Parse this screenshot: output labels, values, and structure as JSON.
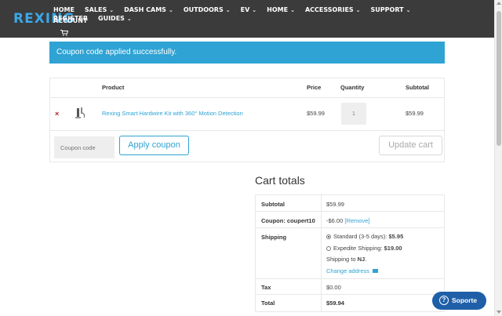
{
  "header": {
    "logo": "REXING",
    "nav": [
      {
        "label": "HOME",
        "dropdown": false
      },
      {
        "label": "SALES",
        "dropdown": true
      },
      {
        "label": "DASH CAMS",
        "dropdown": true
      },
      {
        "label": "OUTDOORS",
        "dropdown": true
      },
      {
        "label": "EV",
        "dropdown": true
      },
      {
        "label": "HOME",
        "dropdown": true
      },
      {
        "label": "ACCESSORIES",
        "dropdown": true
      },
      {
        "label": "SUPPORT",
        "dropdown": true
      },
      {
        "label": "REGISTER",
        "dropdown": false
      },
      {
        "label": "GUIDES",
        "dropdown": true
      }
    ],
    "nav_row2": "ACCOUNT",
    "chevron": "⌄",
    "cart_icon": "cart-icon"
  },
  "notice": {
    "text": "Coupon code applied successfully."
  },
  "cart": {
    "headers": {
      "product": "Product",
      "price": "Price",
      "quantity": "Quantity",
      "subtotal": "Subtotal"
    },
    "item": {
      "remove": "×",
      "name": "Rexing Smart Hardwire Kit with 360° Motion Detection",
      "price": "$59.99",
      "quantity": "1",
      "subtotal": "$59.99"
    },
    "coupon_placeholder": "Coupon code",
    "apply_label": "Apply coupon",
    "update_label": "Update cart"
  },
  "totals": {
    "title": "Cart totals",
    "subtotal_label": "Subtotal",
    "subtotal_value": "$59.99",
    "coupon_label": "Coupon: coupert10",
    "coupon_value": "-$6.00",
    "coupon_remove": "[Remove]",
    "shipping_label": "Shipping",
    "shipping_standard": "Standard (3-5 days):",
    "shipping_standard_price": "$5.95",
    "shipping_expedite": "Expedite Shipping:",
    "shipping_expedite_price": "$19.00",
    "shipping_to": "Shipping to",
    "shipping_state": "NJ",
    "change_address": "Change address",
    "tax_label": "Tax",
    "tax_value": "$0.00",
    "total_label": "Total",
    "total_value": "$59.94"
  },
  "support": {
    "label": "Soporte",
    "icon": "?"
  },
  "colors": {
    "header_bg": "#3b3b3b",
    "accent": "#2ea3d4",
    "support_bg": "#1f5fa8"
  }
}
